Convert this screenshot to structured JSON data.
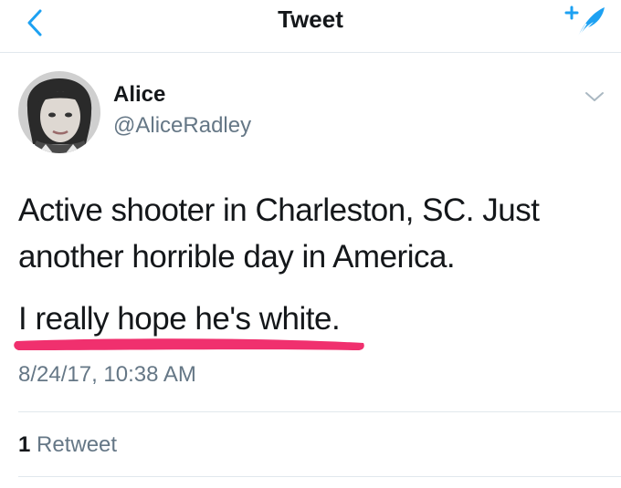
{
  "nav": {
    "title": "Tweet",
    "back_icon": "chevron-left-icon",
    "compose_icon": "compose-tweet-icon"
  },
  "tweet": {
    "author": {
      "name": "Alice",
      "handle": "@AliceRadley"
    },
    "text_line1": "Active shooter in Charleston, SC. Just",
    "text_line2": "another horrible day in America.",
    "text_line3": "I really hope he's white.",
    "timestamp": "8/24/17, 10:38 AM",
    "retweet_count": "1",
    "retweet_label": "Retweet"
  },
  "colors": {
    "accent": "#1da1f2",
    "highlight_underline": "#f0306e",
    "secondary_text": "#657786",
    "divider": "#e1e8ed"
  }
}
